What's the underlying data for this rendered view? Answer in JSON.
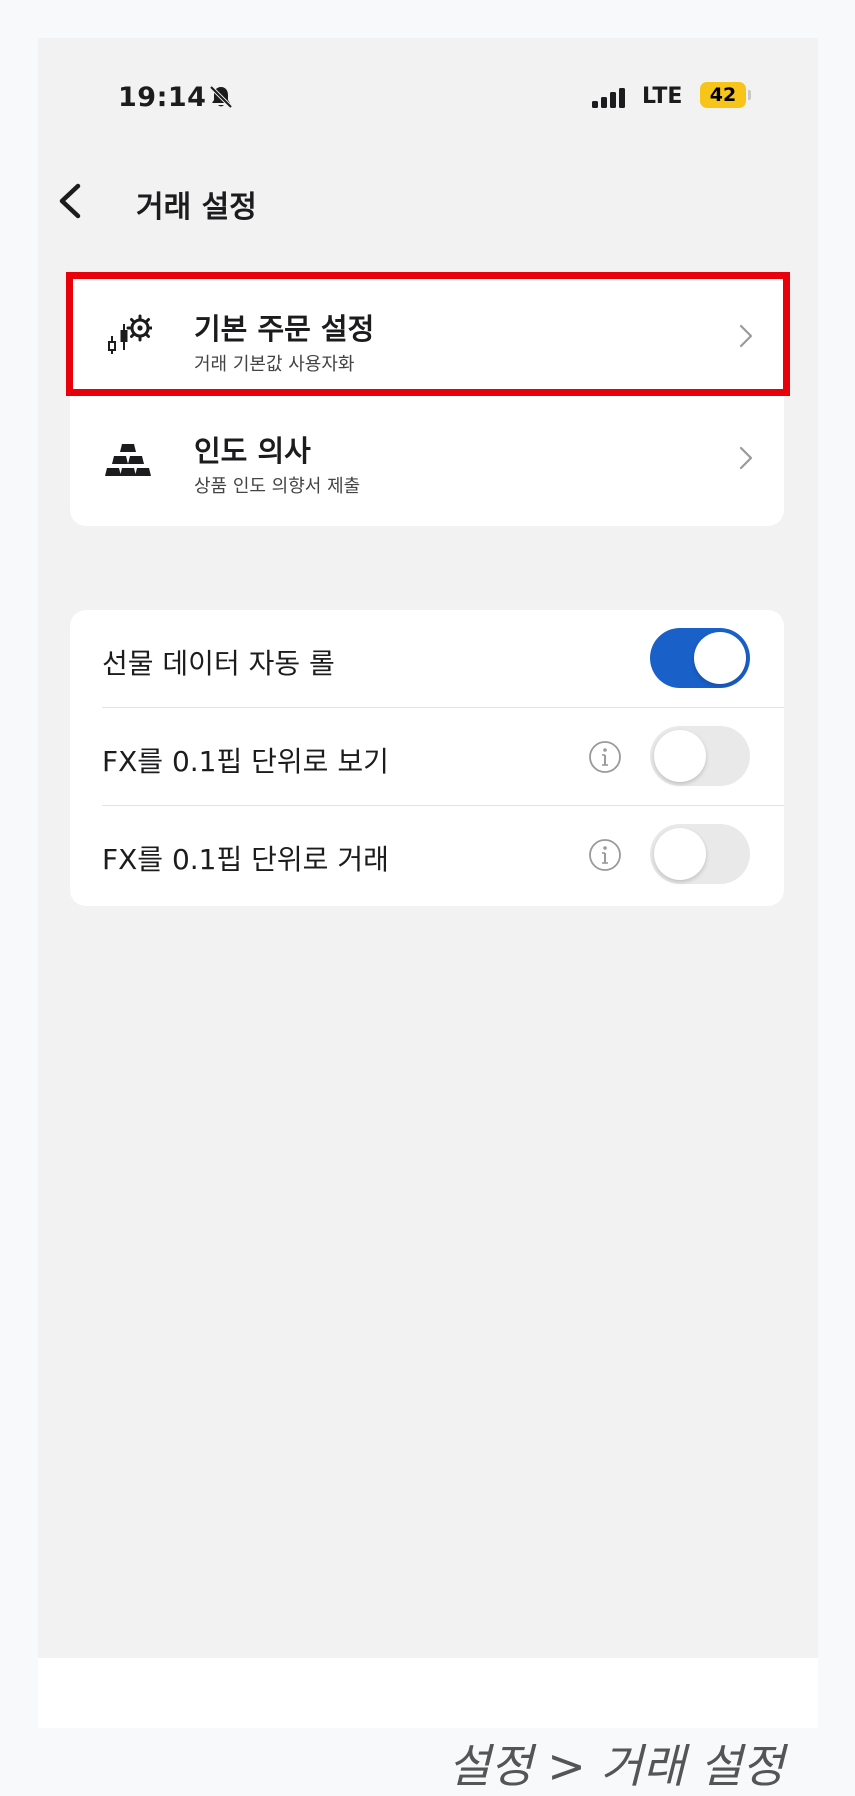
{
  "status_bar": {
    "time": "19:14",
    "network": "LTE",
    "battery": "42"
  },
  "header": {
    "title": "거래 설정"
  },
  "menu": [
    {
      "title": "기본 주문 설정",
      "subtitle": "거래 기본값 사용자화",
      "icon": "candlestick-gear-icon"
    },
    {
      "title": "인도 의사",
      "subtitle": "상품 인도 의향서 제출",
      "icon": "gold-bars-icon"
    }
  ],
  "toggles": [
    {
      "label": "선물 데이터 자동 롤",
      "on": true,
      "info": false
    },
    {
      "label": "FX를 0.1핍 단위로 보기",
      "on": false,
      "info": true
    },
    {
      "label": "FX를 0.1핍 단위로 거래",
      "on": false,
      "info": true
    }
  ],
  "caption": "설정 > 거래 설정",
  "colors": {
    "highlight": "#e8000b",
    "toggle_on": "#1960c9",
    "battery": "#f7c51a"
  }
}
